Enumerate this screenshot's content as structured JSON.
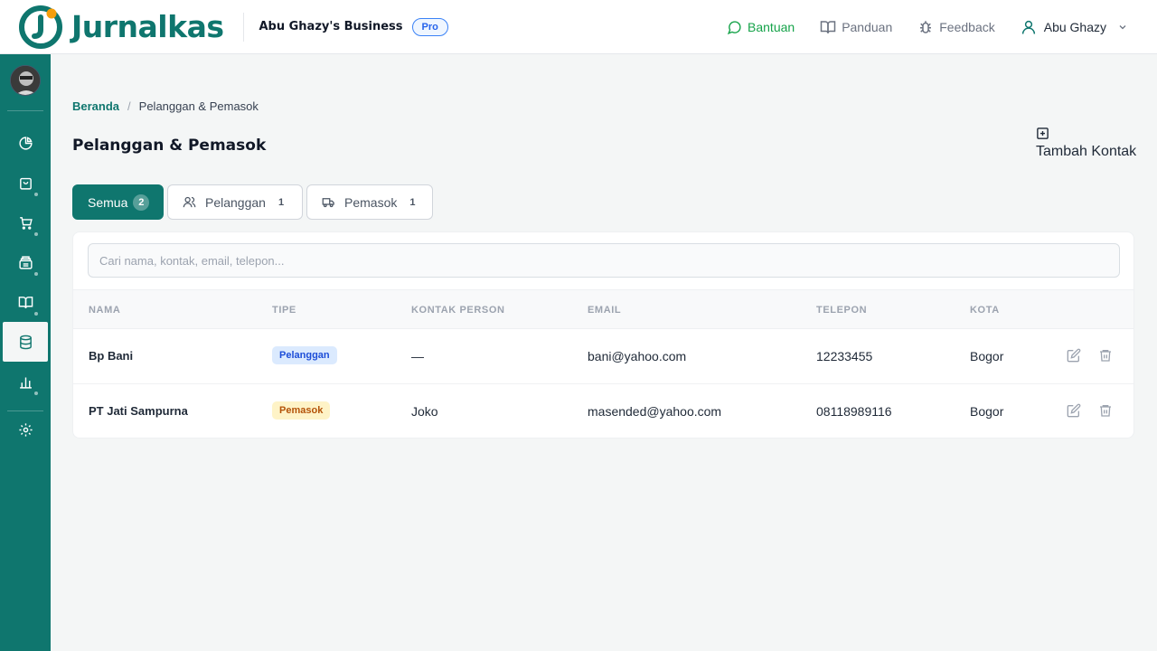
{
  "app": {
    "name": "Jurnalkas",
    "business": "Abu Ghazy's Business",
    "plan": "Pro"
  },
  "header": {
    "help_label": "Bantuan",
    "guide_label": "Panduan",
    "feedback_label": "Feedback",
    "user_name": "Abu Ghazy"
  },
  "breadcrumb": {
    "home": "Beranda",
    "current": "Pelanggan & Pemasok"
  },
  "page": {
    "title": "Pelanggan & Pemasok",
    "add_label": "Tambah Kontak"
  },
  "tabs": [
    {
      "label": "Semua",
      "count": "2",
      "active": true
    },
    {
      "label": "Pelanggan",
      "count": "1",
      "icon": "users-icon"
    },
    {
      "label": "Pemasok",
      "count": "1",
      "icon": "truck-icon"
    }
  ],
  "search": {
    "placeholder": "Cari nama, kontak, email, telepon..."
  },
  "table": {
    "columns": [
      "NAMA",
      "TIPE",
      "KONTAK PERSON",
      "EMAIL",
      "TELEPON",
      "KOTA"
    ],
    "rows": [
      {
        "name": "Bp Bani",
        "type": "Pelanggan",
        "contact": "—",
        "email": "bani@yahoo.com",
        "phone": "12233455",
        "city": "Bogor"
      },
      {
        "name": "PT Jati Sampurna",
        "type": "Pemasok",
        "contact": "Joko",
        "email": "masended@yahoo.com",
        "phone": "08118989116",
        "city": "Bogor"
      }
    ]
  },
  "colors": {
    "brand": "#0f766e",
    "help_green": "#16a34a",
    "pro_blue": "#2563eb",
    "badge_customer": "#dbeafe",
    "badge_supplier": "#fef3c7"
  },
  "sidebar": {
    "icons": [
      "avatar",
      "pie-chart-icon",
      "shopping-bag-icon",
      "cart-icon",
      "archive-icon",
      "book-icon",
      "database-icon",
      "bar-chart-icon",
      "gear-icon"
    ],
    "active": "database-icon"
  }
}
